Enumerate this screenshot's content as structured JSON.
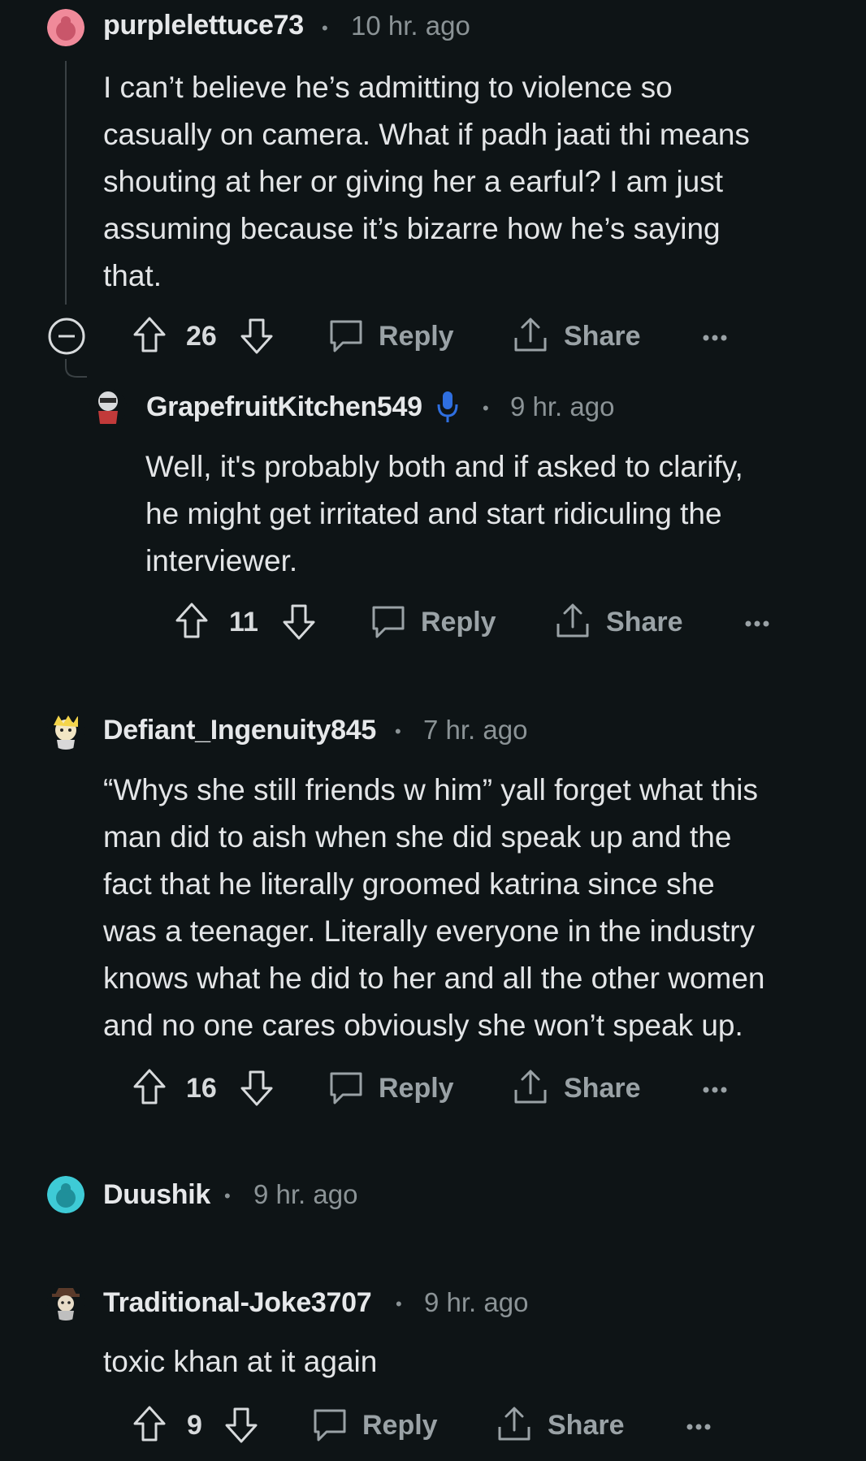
{
  "comments": [
    {
      "username": "purplelettuce73",
      "time": "10 hr. ago",
      "lines": [
        "I can’t believe he’s admitting to violence so",
        "casually on camera. What if padh jaati thi means",
        "shouting at her or giving her a earful? I am just",
        "assuming because it’s bizarre how he’s saying",
        "that."
      ],
      "votes": "26",
      "reply_label": "Reply",
      "share_label": "Share",
      "avatar_color": "#f08a9a"
    },
    {
      "username": "GrapefruitKitchen549",
      "time": "9 hr. ago",
      "lines": [
        "Well, it's probably both and if asked to clarify,",
        "he might get irritated and start ridiculing the",
        "interviewer."
      ],
      "votes": "11",
      "reply_label": "Reply",
      "share_label": "Share"
    },
    {
      "username": "Defiant_Ingenuity845",
      "time": "7 hr. ago",
      "lines": [
        "“Whys she still friends w him” yall forget what this",
        "man did to aish when she did speak up and the",
        "fact that he literally groomed katrina since she",
        "was a teenager. Literally everyone in the industry",
        "knows what he did to her and all the other women",
        "and no one cares obviously she won’t speak up."
      ],
      "votes": "16",
      "reply_label": "Reply",
      "share_label": "Share"
    },
    {
      "username": "Duushik",
      "time": "9 hr. ago",
      "avatar_color": "#3ecbd6"
    },
    {
      "username": "Traditional-Joke3707",
      "time": "9 hr. ago",
      "lines": [
        "toxic khan at it again"
      ],
      "votes": "9",
      "reply_label": "Reply",
      "share_label": "Share"
    }
  ],
  "separator": "•",
  "colors": {
    "background": "#0e1416",
    "mic_blue": "#2f6fe0"
  }
}
